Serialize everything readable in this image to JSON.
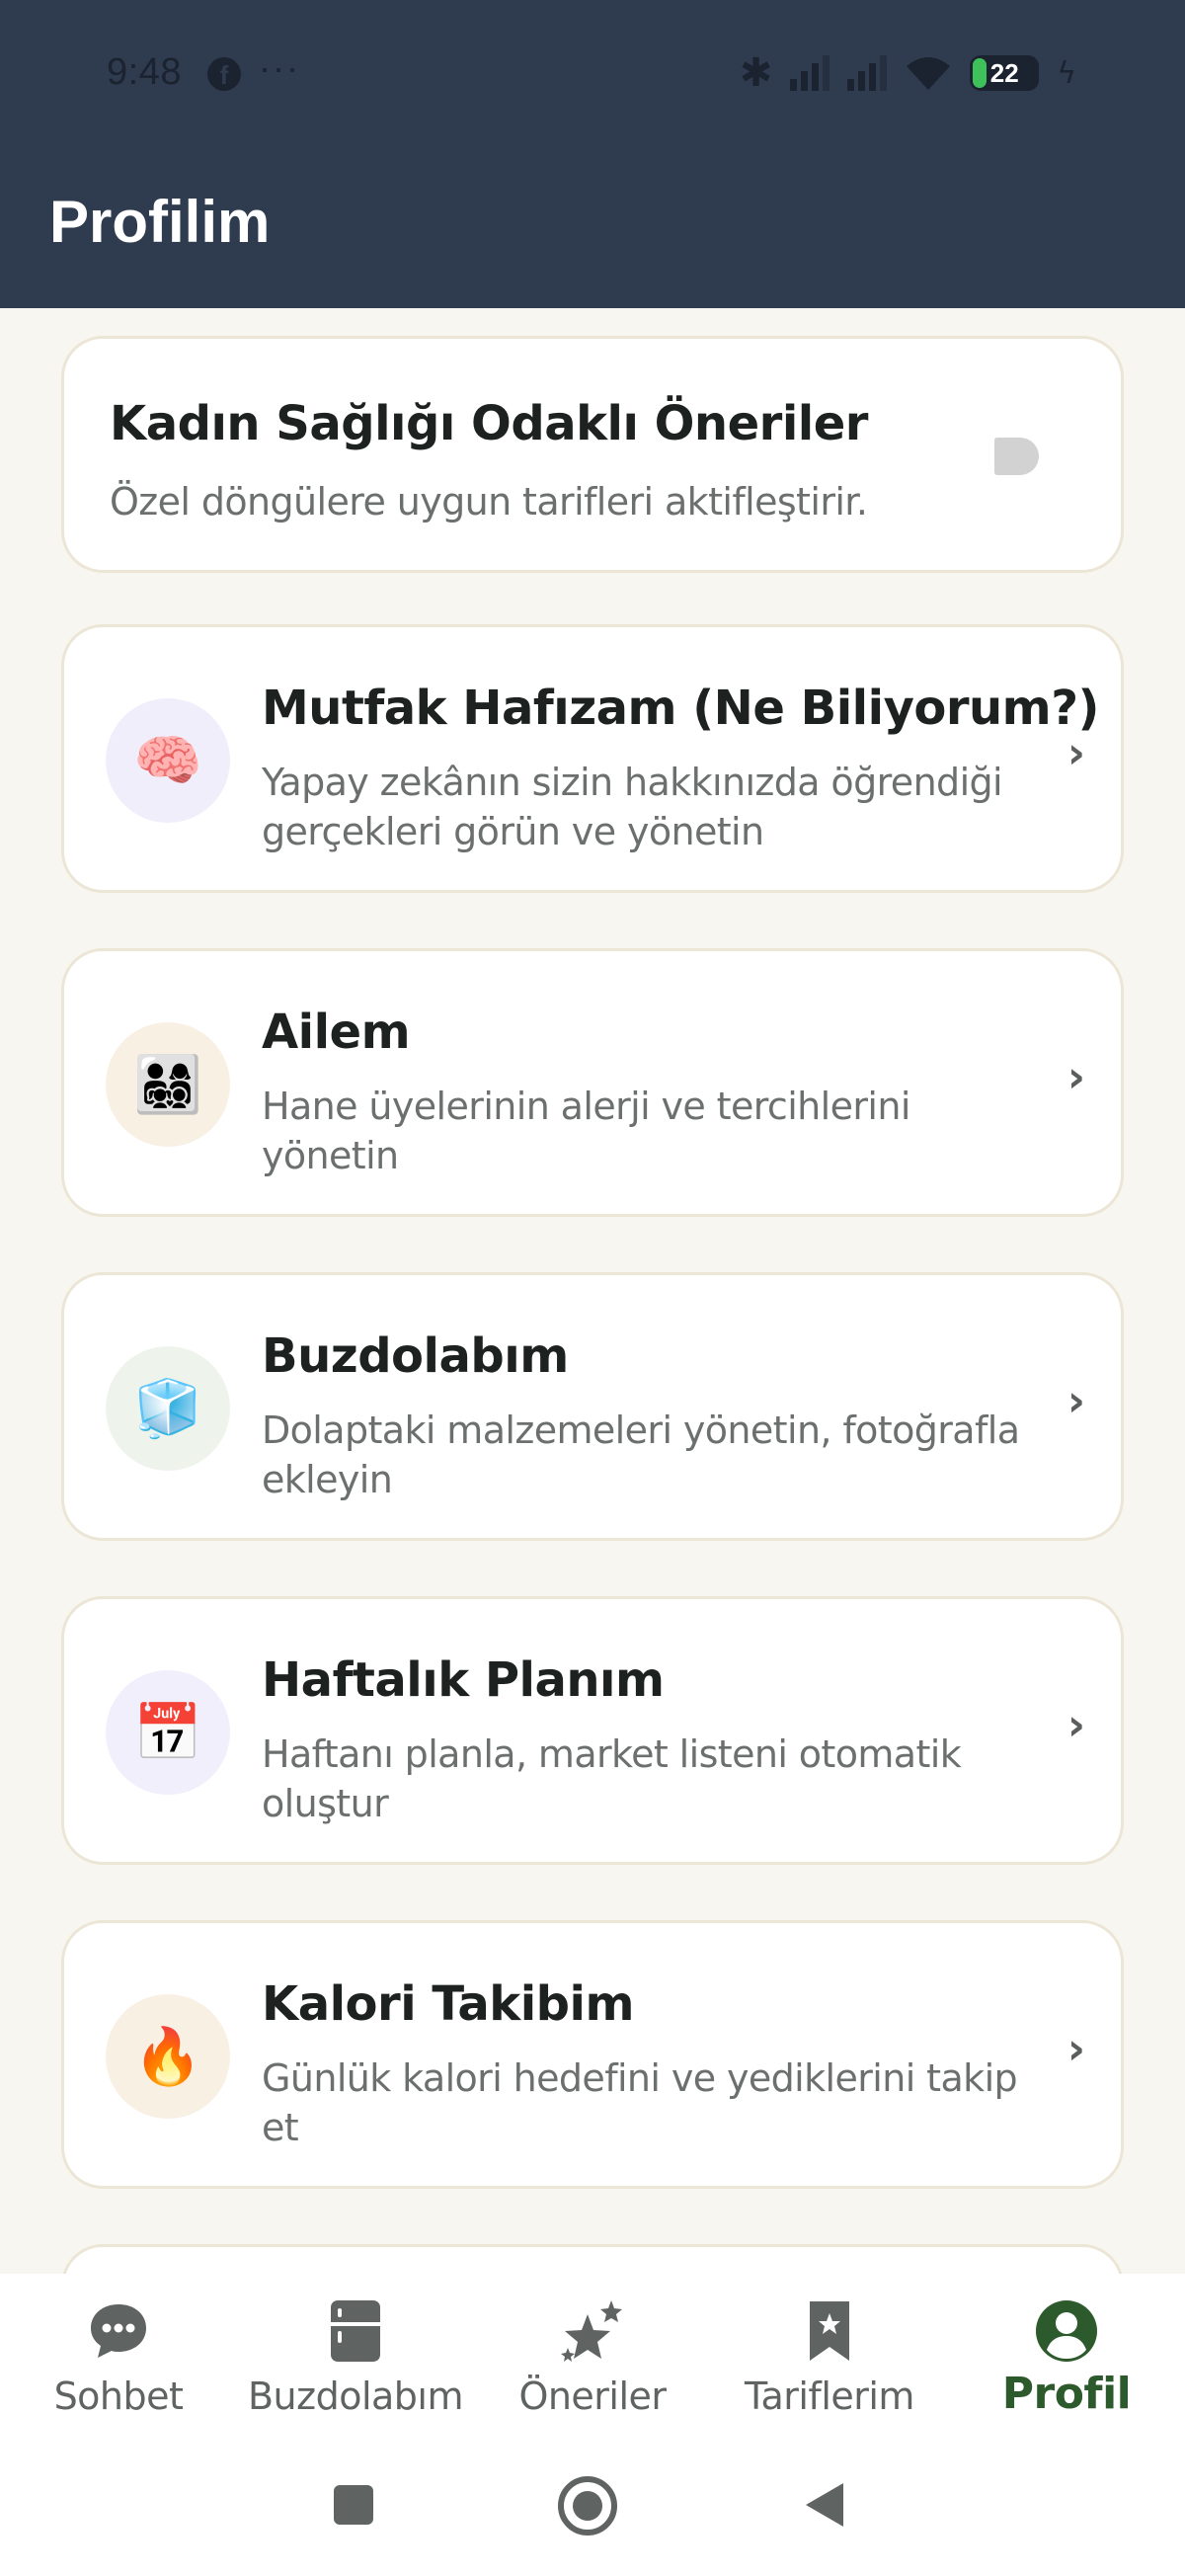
{
  "status_bar": {
    "time": "9:48",
    "battery": "22"
  },
  "header": {
    "title": "Profilim"
  },
  "toggle_card": {
    "title": "Kadın Sağlığı Odaklı Öneriler",
    "description": "Özel döngülere uygun tarifleri aktifleştirir.",
    "enabled": false
  },
  "menu": [
    {
      "title": "Mutfak Hafızam (Ne Biliyorum?)",
      "line1": "Yapay zekânın sizin hakkınızda öğrendiği",
      "line2": "gerçekleri görün ve yönetin",
      "icon": "brain-icon",
      "glyph": "🧠",
      "bg": "#f1eefb"
    },
    {
      "title": "Ailem",
      "line1": "Hane üyelerinin alerji ve tercihlerini",
      "line2": "yönetin",
      "icon": "family-icon",
      "glyph": "👨‍👩‍👧‍👦",
      "bg": "#f8f0e2"
    },
    {
      "title": "Buzdolabım",
      "line1": "Dolaptaki malzemeleri yönetin, fotoğrafla",
      "line2": "ekleyin",
      "icon": "ice-cube-icon",
      "glyph": "🧊",
      "bg": "#eef4ec"
    },
    {
      "title": "Haftalık Planım",
      "line1": "Haftanı planla, market listeni otomatik",
      "line2": "oluştur",
      "icon": "calendar-icon",
      "glyph": "📅",
      "bg": "#f0effb"
    },
    {
      "title": "Kalori Takibim",
      "line1": "Günlük kalori hedefini ve yediklerini takip",
      "line2": "et",
      "icon": "fire-icon",
      "glyph": "🔥",
      "bg": "#f8f0e2"
    }
  ],
  "bottom_nav": [
    {
      "label": "Sohbet",
      "icon": "chat-icon",
      "active": false
    },
    {
      "label": "Buzdolabım",
      "icon": "fridge-icon",
      "active": false
    },
    {
      "label": "Öneriler",
      "icon": "sparkle-stars-icon",
      "active": false
    },
    {
      "label": "Tariflerim",
      "icon": "bookmark-icon",
      "active": false
    },
    {
      "label": "Profil",
      "icon": "profile-icon",
      "active": true
    }
  ],
  "colors": {
    "header": "#2f3b4e",
    "accent": "#2d5a2c",
    "background": "#f8f6f1",
    "card_border": "#ece6d6"
  }
}
